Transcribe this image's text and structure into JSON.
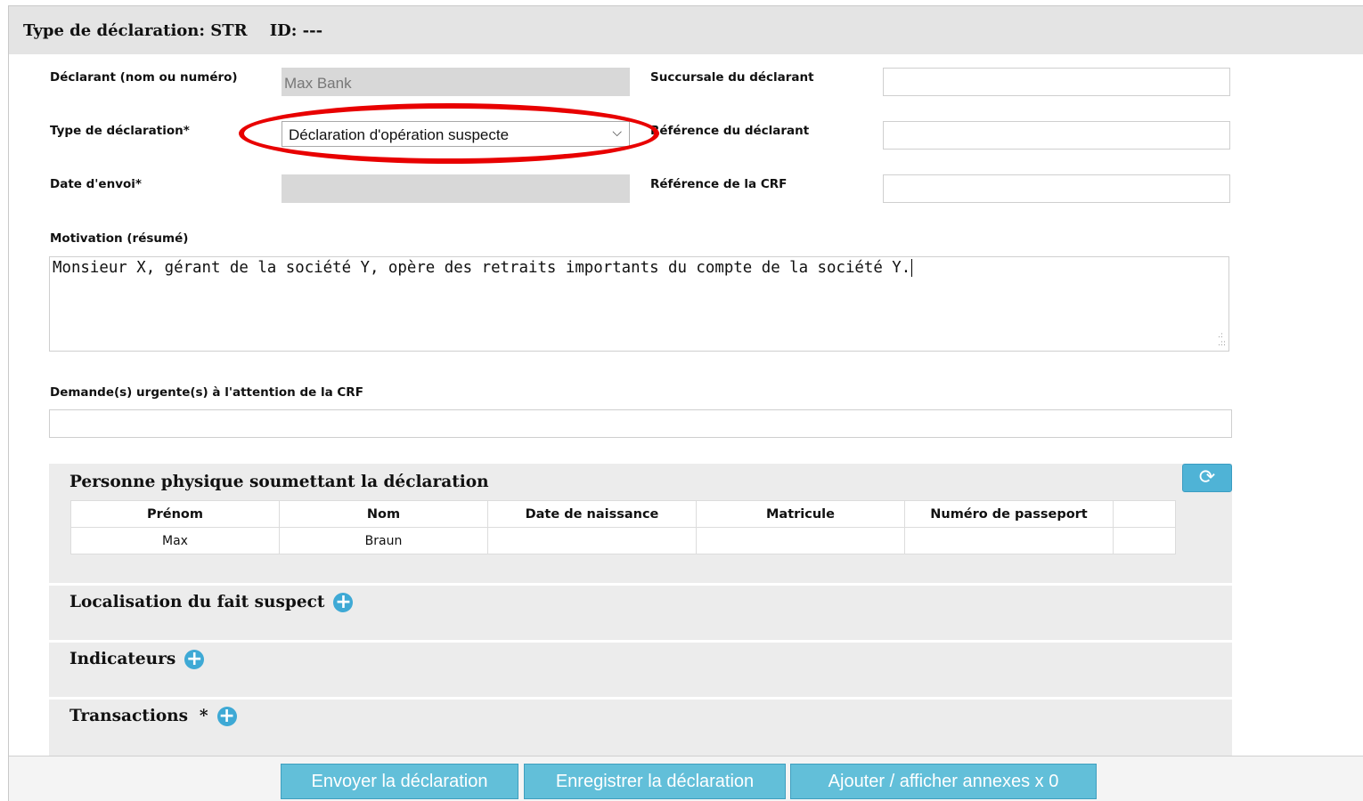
{
  "header": {
    "title": "Type de déclaration: STR    ID: ---"
  },
  "form": {
    "declarant_label": "Déclarant (nom ou numéro)",
    "declarant_value": "Max Bank",
    "branch_label": "Succursale du déclarant",
    "branch_value": "",
    "type_label": "Type de déclaration*",
    "type_value": "Déclaration d'opération suspecte",
    "declarant_ref_label": "Référence du déclarant",
    "declarant_ref_value": "",
    "send_date_label": "Date d'envoi*",
    "send_date_value": "",
    "crf_ref_label": "Référence de la CRF",
    "crf_ref_value": "",
    "motivation_label": "Motivation (résumé)",
    "motivation_value": "Monsieur X, gérant de la société Y, opère des retraits importants du compte de la société Y.",
    "urgent_label": "Demande(s) urgente(s) à l'attention de la CRF",
    "urgent_value": ""
  },
  "person_panel": {
    "title": "Personne physique soumettant la déclaration",
    "refresh_icon": "refresh-icon",
    "columns": [
      "Prénom",
      "Nom",
      "Date de naissance",
      "Matricule",
      "Numéro de passeport",
      ""
    ],
    "rows": [
      [
        "Max",
        "Braun",
        "",
        "",
        "",
        ""
      ]
    ]
  },
  "sections": {
    "location": "Localisation du fait suspect",
    "indicators": "Indicateurs",
    "transactions": "Transactions  *"
  },
  "footer": {
    "send_label": "Envoyer la déclaration",
    "save_label": "Enregistrer la déclaration",
    "annex_label": "Ajouter / afficher annexes x 0"
  },
  "colors": {
    "accent": "#62bfd9",
    "highlight": "#e80000",
    "header_bg": "#e4e4e4"
  }
}
